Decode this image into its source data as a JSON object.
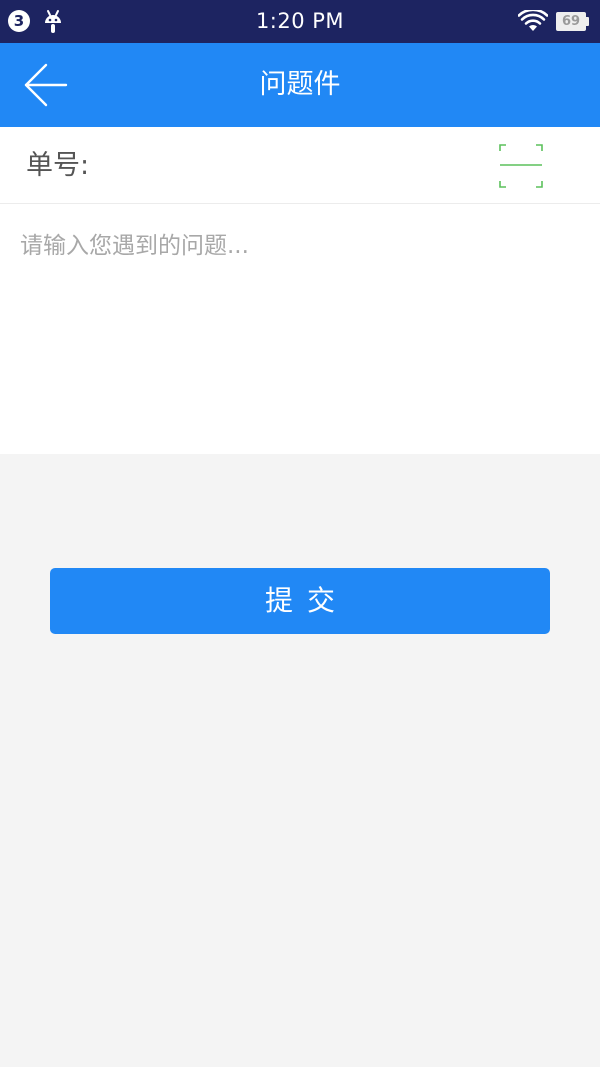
{
  "status_bar": {
    "notification_count": "3",
    "time": "1:20 PM",
    "battery_level": "69",
    "icons": [
      "notification-badge",
      "android-icon",
      "wifi-icon",
      "battery-icon"
    ]
  },
  "header": {
    "title": "问题件",
    "back_icon": "arrow-left-icon",
    "background_color": "#2188f5"
  },
  "form": {
    "order_number_label": "单号:",
    "order_number_value": "",
    "scan_icon": "scan-code-icon",
    "problem_placeholder": "请输入您遇到的问题...",
    "problem_value": ""
  },
  "actions": {
    "submit_label": "提交"
  },
  "colors": {
    "primary": "#2188f5",
    "status_bar": "#1d2461",
    "scan_accent": "#5cc15c",
    "page_background": "#f4f4f4"
  }
}
